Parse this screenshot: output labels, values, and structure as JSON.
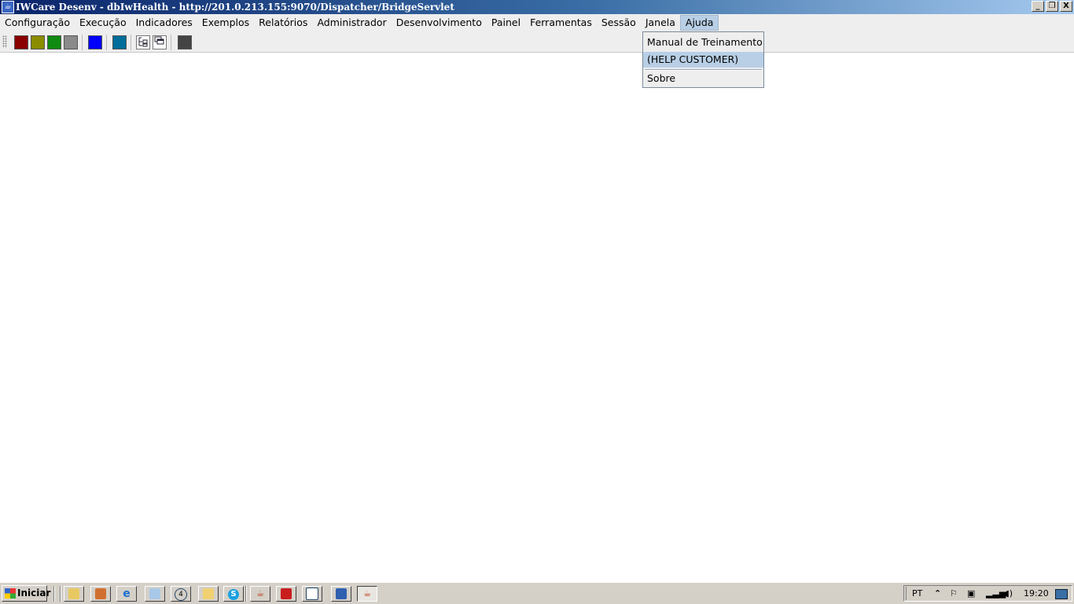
{
  "window": {
    "title": "IWCare Desenv - dbIwHealth - http://201.0.213.155:9070/Dispatcher/BridgeServlet",
    "app_icon": "java-app-icon",
    "controls": {
      "minimize": "_",
      "restore": "❐",
      "close": "X"
    }
  },
  "menubar": {
    "items": [
      {
        "label": "Configuração"
      },
      {
        "label": "Execução"
      },
      {
        "label": "Indicadores"
      },
      {
        "label": "Exemplos"
      },
      {
        "label": "Relatórios"
      },
      {
        "label": "Administrador"
      },
      {
        "label": "Desenvolvimento"
      },
      {
        "label": "Painel"
      },
      {
        "label": "Ferramentas"
      },
      {
        "label": "Sessão"
      },
      {
        "label": "Janela"
      },
      {
        "label": "Ajuda"
      }
    ],
    "active": "Ajuda"
  },
  "toolbar": {
    "buttons": [
      {
        "name": "color-button-darkred",
        "color": "#8b0000"
      },
      {
        "name": "color-button-olive",
        "color": "#8c8c00"
      },
      {
        "name": "color-button-green",
        "color": "#108a10"
      },
      {
        "name": "color-button-gray",
        "color": "#8a8a8a"
      },
      {
        "name": "color-button-blue",
        "color": "#0000ff"
      },
      {
        "name": "color-button-teal",
        "color": "#006d9a"
      },
      {
        "name": "tree-view-icon",
        "color": "#ffffff"
      },
      {
        "name": "window-cascade-icon",
        "color": "#ffffff"
      },
      {
        "name": "color-button-darkgray",
        "color": "#444444"
      }
    ]
  },
  "dropdown": {
    "items": [
      {
        "label": "Manual de Treinamento",
        "highlighted": false
      },
      {
        "label": "(HELP CUSTOMER)",
        "highlighted": true
      },
      {
        "label": "Sobre",
        "highlighted": false
      }
    ]
  },
  "taskbar": {
    "start_label": "Iniciar",
    "language": "PT",
    "clock": "19:20",
    "icons": [
      "folder-icon",
      "media-icon",
      "ie-icon",
      "notepad-icon",
      "counter-icon",
      "explorer-icon",
      "skype-icon",
      "java-icon",
      "pdf-icon",
      "document-icon",
      "network-icon",
      "java-app-icon"
    ],
    "tray_icons": [
      "chevron-up-icon",
      "flag-icon",
      "printer-icon",
      "signal-icon",
      "volume-icon",
      "monitor-icon"
    ]
  }
}
